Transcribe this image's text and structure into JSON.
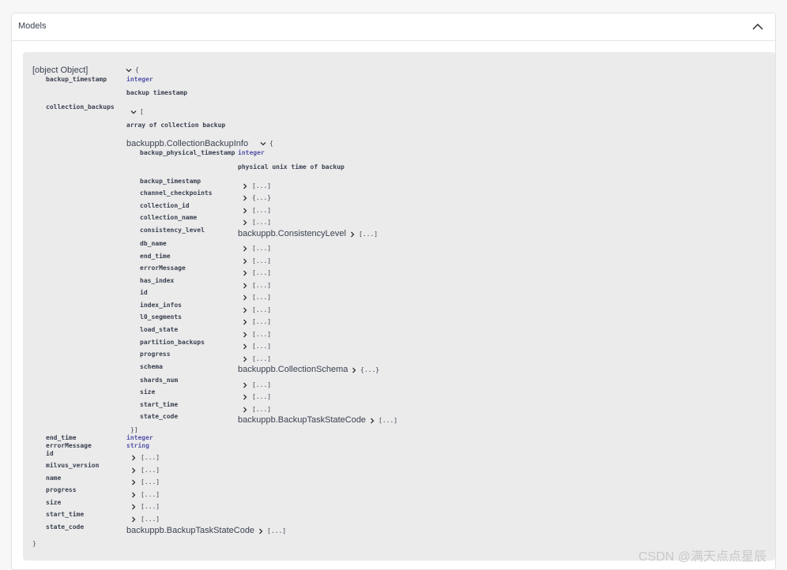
{
  "section": {
    "title": "Models"
  },
  "watermark": "CSDN @满天点点星辰",
  "model": {
    "name": {
      "key": "name",
      "collapsed": "[...]"
    },
    "open": "{",
    "close": "}",
    "backup_timestamp": {
      "key": "backup_timestamp",
      "type": "integer",
      "description": "backup timestamp"
    },
    "collection_backups": {
      "key": "collection_backups",
      "open": "[",
      "close": "}]",
      "description": "array of collection backup",
      "item": {
        "name": "backuppb.CollectionBackupInfo",
        "open": "{",
        "backup_physical_timestamp": {
          "key": "backup_physical_timestamp",
          "type": "integer",
          "description": "physical unix time of backup"
        },
        "fields": [
          {
            "key": "backup_timestamp",
            "collapsed": "[...]"
          },
          {
            "key": "channel_checkpoints",
            "collapsed": "{...}"
          },
          {
            "key": "collection_id",
            "collapsed": "[...]"
          },
          {
            "key": "collection_name",
            "collapsed": "[...]"
          },
          {
            "key": "consistency_level",
            "ref": "backuppb.ConsistencyLevel",
            "collapsed": "[...]"
          },
          {
            "key": "db_name",
            "collapsed": "[...]"
          },
          {
            "key": "end_time",
            "collapsed": "[...]"
          },
          {
            "key": "errorMessage",
            "collapsed": "[...]"
          },
          {
            "key": "has_index",
            "collapsed": "[...]"
          },
          {
            "key": "id",
            "collapsed": "[...]"
          },
          {
            "key": "index_infos",
            "collapsed": "[...]"
          },
          {
            "key": "l0_segments",
            "collapsed": "[...]"
          },
          {
            "key": "load_state",
            "collapsed": "[...]"
          },
          {
            "key": "partition_backups",
            "collapsed": "[...]"
          },
          {
            "key": "progress",
            "collapsed": "[...]"
          },
          {
            "key": "schema",
            "ref": "backuppb.CollectionSchema",
            "collapsed": "{...}"
          },
          {
            "key": "shards_num",
            "collapsed": "[...]"
          },
          {
            "key": "size",
            "collapsed": "[...]"
          },
          {
            "key": "start_time",
            "collapsed": "[...]"
          },
          {
            "key": "state_code",
            "ref": "backuppb.BackupTaskStateCode",
            "collapsed": "[...]"
          }
        ]
      }
    },
    "end_time": {
      "key": "end_time",
      "type": "integer"
    },
    "errorMessage": {
      "key": "errorMessage",
      "type": "string"
    },
    "id": {
      "key": "id",
      "collapsed": "[...]"
    },
    "milvus_version": {
      "key": "milvus_version",
      "collapsed": "[...]"
    },
    "progress": {
      "key": "progress",
      "collapsed": "[...]"
    },
    "size": {
      "key": "size",
      "collapsed": "[...]"
    },
    "start_time": {
      "key": "start_time",
      "collapsed": "[...]"
    },
    "state_code": {
      "key": "state_code",
      "ref": "backuppb.BackupTaskStateCode",
      "collapsed": "[...]"
    }
  }
}
